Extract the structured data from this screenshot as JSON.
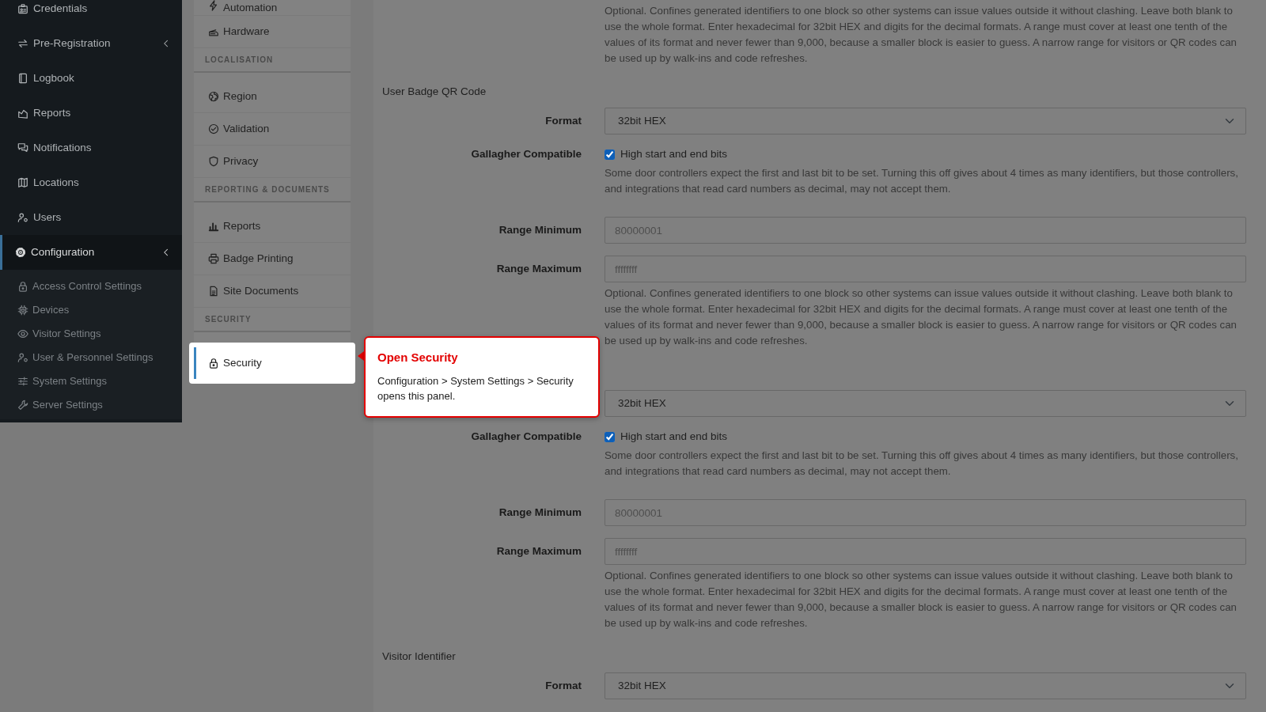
{
  "sidebar": {
    "items": [
      {
        "label": "Credentials",
        "selected": false,
        "expandable": false
      },
      {
        "label": "Pre-Registration",
        "selected": false,
        "expandable": true
      },
      {
        "label": "Logbook",
        "selected": false,
        "expandable": false
      },
      {
        "label": "Reports",
        "selected": false,
        "expandable": false
      },
      {
        "label": "Notifications",
        "selected": false,
        "expandable": false
      },
      {
        "label": "Locations",
        "selected": false,
        "expandable": false
      },
      {
        "label": "Users",
        "selected": false,
        "expandable": false
      },
      {
        "label": "Configuration",
        "selected": true,
        "expandable": true,
        "children": [
          {
            "label": "Access Control Settings",
            "selected": false
          },
          {
            "label": "Devices",
            "selected": false
          },
          {
            "label": "Visitor Settings",
            "selected": false
          },
          {
            "label": "User & Personnel Settings",
            "selected": false
          },
          {
            "label": "System Settings",
            "selected": false
          },
          {
            "label": "Server Settings",
            "selected": false
          }
        ]
      }
    ]
  },
  "settings_nav": {
    "groups": [
      {
        "items": [
          {
            "label": "Automation",
            "selected": false
          },
          {
            "label": "Hardware",
            "selected": false
          }
        ]
      },
      {
        "heading": "LOCALISATION",
        "items": [
          {
            "label": "Region",
            "selected": false
          },
          {
            "label": "Validation",
            "selected": false
          },
          {
            "label": "Privacy",
            "selected": false
          }
        ]
      },
      {
        "heading": "REPORTING & DOCUMENTS",
        "items": [
          {
            "label": "Reports",
            "selected": false
          },
          {
            "label": "Badge Printing",
            "selected": false
          },
          {
            "label": "Site Documents",
            "selected": false
          }
        ]
      },
      {
        "heading": "SECURITY",
        "items": [
          {
            "label": "Security",
            "selected": true
          }
        ]
      }
    ]
  },
  "content": {
    "leading_help": "Optional. Confines generated identifiers to one block so other systems can issue values outside it without clashing. Leave both blank to use the whole format. Enter hexadecimal for 32bit HEX and digits for the decimal formats. A range must cover at least one tenth of the values of its format and never fewer than 9,000, because a smaller block is easier to guess. A narrow range for visitors or QR codes can be used up by walk-ins and code refreshes.",
    "sections": [
      {
        "heading": "User Badge QR Code",
        "fields": [
          {
            "kind": "select",
            "label": "Format",
            "value": "32bit HEX"
          },
          {
            "kind": "checkbox",
            "label": "Gallagher Compatible",
            "text": "High start and end bits",
            "checked": true,
            "help": "Some door controllers expect the first and last bit to be set. Turning this off gives about 4 times as many identifiers, but those controllers, and integrations that read card numbers as decimal, may not accept them."
          },
          {
            "kind": "input",
            "label": "Range Minimum",
            "placeholder": "80000001"
          },
          {
            "kind": "input",
            "label": "Range Maximum",
            "placeholder": "ffffffff",
            "help": "Optional. Confines generated identifiers to one block so other systems can issue values outside it without clashing. Leave both blank to use the whole format. Enter hexadecimal for 32bit HEX and digits for the decimal formats. A range must cover at least one tenth of the values of its format and never fewer than 9,000, because a smaller block is easier to guess. A narrow range for visitors or QR codes can be used up by walk-ins and code refreshes."
          }
        ]
      },
      {
        "fields": [
          {
            "kind": "select",
            "value": "32bit HEX"
          },
          {
            "kind": "checkbox",
            "label": "Gallagher Compatible",
            "text": "High start and end bits",
            "checked": true,
            "help": "Some door controllers expect the first and last bit to be set. Turning this off gives about 4 times as many identifiers, but those controllers, and integrations that read card numbers as decimal, may not accept them."
          },
          {
            "kind": "input",
            "label": "Range Minimum",
            "placeholder": "80000001"
          },
          {
            "kind": "input",
            "label": "Range Maximum",
            "placeholder": "ffffffff",
            "help": "Optional. Confines generated identifiers to one block so other systems can issue values outside it without clashing. Leave both blank to use the whole format. Enter hexadecimal for 32bit HEX and digits for the decimal formats. A range must cover at least one tenth of the values of its format and never fewer than 9,000, because a smaller block is easier to guess. A narrow range for visitors or QR codes can be used up by walk-ins and code refreshes."
          }
        ]
      },
      {
        "heading": "Visitor Identifier",
        "fields": [
          {
            "kind": "select",
            "label": "Format",
            "value": "32bit HEX"
          }
        ]
      }
    ]
  },
  "tooltip": {
    "title": "Open Security",
    "body": "Configuration > System Settings > Security opens this panel."
  }
}
